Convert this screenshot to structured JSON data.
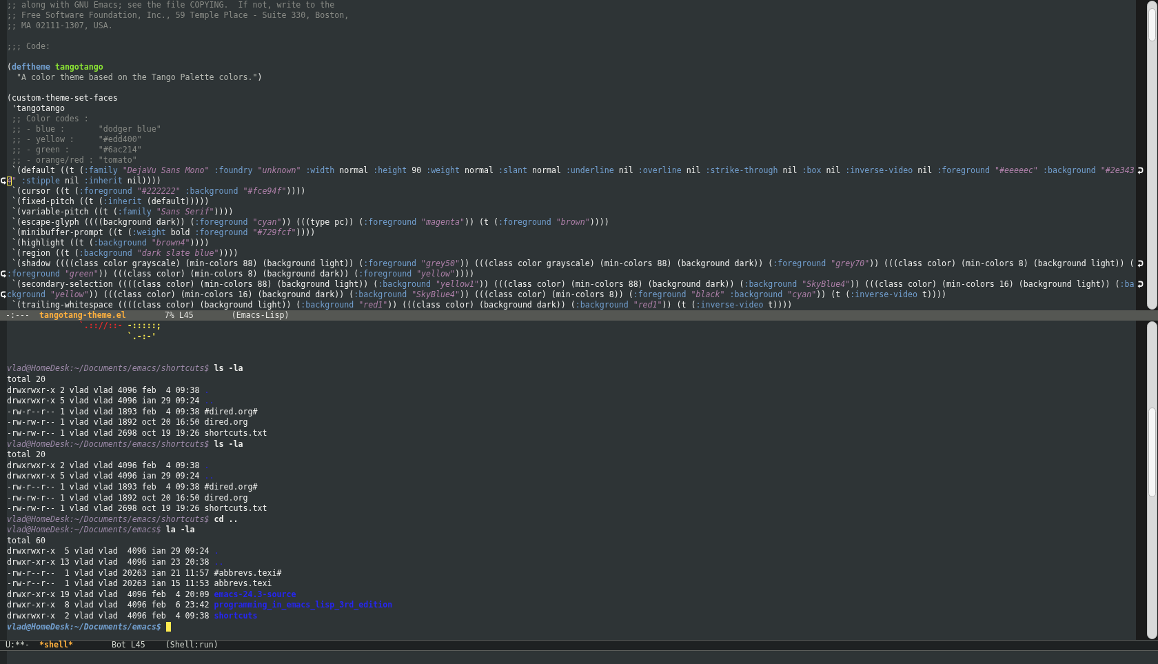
{
  "windows": [
    {
      "selected": false,
      "lines": [
        {
          "kind": "text",
          "wrapped": false,
          "continued": false,
          "cursor": false,
          "segments": [
            {
              "kind": "comment",
              "text": ";; along with GNU Emacs; see the file COPYING.  If not, write to the"
            }
          ]
        },
        {
          "kind": "text",
          "wrapped": false,
          "continued": false,
          "cursor": false,
          "segments": [
            {
              "kind": "comment",
              "text": ";; Free Software Foundation, Inc., 59 Temple Place - Suite 330, Boston,"
            }
          ]
        },
        {
          "kind": "text",
          "wrapped": false,
          "continued": false,
          "cursor": false,
          "segments": [
            {
              "kind": "comment",
              "text": ";; MA 02111-1307, USA."
            }
          ]
        },
        {
          "kind": "blank",
          "wrapped": false,
          "continued": false,
          "cursor": false
        },
        {
          "kind": "text",
          "wrapped": false,
          "continued": false,
          "cursor": false,
          "segments": [
            {
              "kind": "comment",
              "text": ";;; Code:"
            }
          ]
        },
        {
          "kind": "blank",
          "wrapped": false,
          "continued": false,
          "cursor": false
        },
        {
          "kind": "text",
          "wrapped": false,
          "continued": false,
          "cursor": false,
          "segments": [
            {
              "kind": "plain",
              "text": "("
            },
            {
              "kind": "builtin",
              "text": "deftheme "
            },
            {
              "kind": "function",
              "text": "tangotango"
            }
          ]
        },
        {
          "kind": "text",
          "wrapped": false,
          "continued": false,
          "cursor": false,
          "segments": [
            {
              "kind": "doc",
              "text": "  \"A color theme based on the Tango Palette colors.\""
            },
            {
              "kind": "plain",
              "text": ")"
            }
          ]
        },
        {
          "kind": "blank",
          "wrapped": false,
          "continued": false,
          "cursor": false
        },
        {
          "kind": "text",
          "wrapped": false,
          "continued": false,
          "cursor": false,
          "segments": [
            {
              "kind": "plain",
              "text": "(custom-theme-set-faces"
            }
          ]
        },
        {
          "kind": "text",
          "wrapped": false,
          "continued": false,
          "cursor": false,
          "segments": [
            {
              "kind": "plain",
              "text": " 'tangotango"
            }
          ]
        },
        {
          "kind": "text",
          "wrapped": false,
          "continued": false,
          "cursor": false,
          "segments": [
            {
              "kind": "comment",
              "text": " ;; Color codes :"
            }
          ]
        },
        {
          "kind": "text",
          "wrapped": false,
          "continued": false,
          "cursor": false,
          "segments": [
            {
              "kind": "comment",
              "text": " ;; - blue :       \"dodger blue\""
            }
          ]
        },
        {
          "kind": "text",
          "wrapped": false,
          "continued": false,
          "cursor": false,
          "segments": [
            {
              "kind": "comment",
              "text": " ;; - yellow :     \"#edd400\""
            }
          ]
        },
        {
          "kind": "text",
          "wrapped": false,
          "continued": false,
          "cursor": false,
          "segments": [
            {
              "kind": "comment",
              "text": " ;; - green :      \"#6ac214\""
            }
          ]
        },
        {
          "kind": "text",
          "wrapped": false,
          "continued": false,
          "cursor": false,
          "segments": [
            {
              "kind": "comment",
              "text": " ;; - orange/red : \"tomato\""
            }
          ]
        },
        {
          "kind": "text",
          "wrapped": true,
          "continued": false,
          "cursor": false,
          "segments": [
            {
              "kind": "plain",
              "text": " `(default ((t ("
            },
            {
              "kind": "keyword",
              "text": ":family "
            },
            {
              "kind": "string",
              "text": "\"DejaVu Sans Mono\""
            },
            {
              "kind": "keyword",
              "text": " :foundry "
            },
            {
              "kind": "string",
              "text": "\"unknown\""
            },
            {
              "kind": "keyword",
              "text": " :width "
            },
            {
              "kind": "plain",
              "text": "normal "
            },
            {
              "kind": "keyword",
              "text": ":height "
            },
            {
              "kind": "plain",
              "text": "90 "
            },
            {
              "kind": "keyword",
              "text": ":weight "
            },
            {
              "kind": "plain",
              "text": "normal "
            },
            {
              "kind": "keyword",
              "text": ":slant "
            },
            {
              "kind": "plain",
              "text": "normal "
            },
            {
              "kind": "keyword",
              "text": ":underline "
            },
            {
              "kind": "plain",
              "text": "nil "
            },
            {
              "kind": "keyword",
              "text": ":overline "
            },
            {
              "kind": "plain",
              "text": "nil "
            },
            {
              "kind": "keyword",
              "text": ":strike-through "
            },
            {
              "kind": "plain",
              "text": "nil "
            },
            {
              "kind": "keyword",
              "text": ":box "
            },
            {
              "kind": "plain",
              "text": "nil "
            },
            {
              "kind": "keyword",
              "text": ":inverse-video "
            },
            {
              "kind": "plain",
              "text": "nil "
            },
            {
              "kind": "keyword",
              "text": ":foreground "
            },
            {
              "kind": "string",
              "text": "\"#eeeeec\""
            },
            {
              "kind": "keyword",
              "text": " :background "
            },
            {
              "kind": "string",
              "text": "\"#2e343"
            }
          ]
        },
        {
          "kind": "text",
          "wrapped": false,
          "continued": true,
          "cursor": true,
          "segments": [
            {
              "kind": "string",
              "text": "4\""
            },
            {
              "kind": "keyword",
              "text": " :stipple "
            },
            {
              "kind": "plain",
              "text": "nil "
            },
            {
              "kind": "keyword",
              "text": ":inherit "
            },
            {
              "kind": "plain",
              "text": "nil))))"
            }
          ]
        },
        {
          "kind": "text",
          "wrapped": false,
          "continued": false,
          "cursor": false,
          "segments": [
            {
              "kind": "plain",
              "text": " `(cursor ((t ("
            },
            {
              "kind": "keyword",
              "text": ":foreground "
            },
            {
              "kind": "string",
              "text": "\"#222222\""
            },
            {
              "kind": "keyword",
              "text": " :background "
            },
            {
              "kind": "string",
              "text": "\"#fce94f\""
            },
            {
              "kind": "plain",
              "text": "))))"
            }
          ]
        },
        {
          "kind": "text",
          "wrapped": false,
          "continued": false,
          "cursor": false,
          "segments": [
            {
              "kind": "plain",
              "text": " `(fixed-pitch ((t ("
            },
            {
              "kind": "keyword",
              "text": ":inherit "
            },
            {
              "kind": "plain",
              "text": "(default)))))"
            }
          ]
        },
        {
          "kind": "text",
          "wrapped": false,
          "continued": false,
          "cursor": false,
          "segments": [
            {
              "kind": "plain",
              "text": " `(variable-pitch ((t ("
            },
            {
              "kind": "keyword",
              "text": ":family "
            },
            {
              "kind": "string",
              "text": "\"Sans Serif\""
            },
            {
              "kind": "plain",
              "text": "))))"
            }
          ]
        },
        {
          "kind": "text",
          "wrapped": false,
          "continued": false,
          "cursor": false,
          "segments": [
            {
              "kind": "plain",
              "text": " `(escape-glyph ((((background dark)) ("
            },
            {
              "kind": "keyword",
              "text": ":foreground "
            },
            {
              "kind": "string",
              "text": "\"cyan\""
            },
            {
              "kind": "plain",
              "text": ")) (((type pc)) ("
            },
            {
              "kind": "keyword",
              "text": ":foreground "
            },
            {
              "kind": "string",
              "text": "\"magenta\""
            },
            {
              "kind": "plain",
              "text": ")) (t ("
            },
            {
              "kind": "keyword",
              "text": ":foreground "
            },
            {
              "kind": "string",
              "text": "\"brown\""
            },
            {
              "kind": "plain",
              "text": "))))"
            }
          ]
        },
        {
          "kind": "text",
          "wrapped": false,
          "continued": false,
          "cursor": false,
          "segments": [
            {
              "kind": "plain",
              "text": " `(minibuffer-prompt ((t ("
            },
            {
              "kind": "keyword",
              "text": ":weight "
            },
            {
              "kind": "plain",
              "text": "bold "
            },
            {
              "kind": "keyword",
              "text": ":foreground "
            },
            {
              "kind": "string",
              "text": "\"#729fcf\""
            },
            {
              "kind": "plain",
              "text": "))))"
            }
          ]
        },
        {
          "kind": "text",
          "wrapped": false,
          "continued": false,
          "cursor": false,
          "segments": [
            {
              "kind": "plain",
              "text": " `(highlight ((t ("
            },
            {
              "kind": "keyword",
              "text": ":background "
            },
            {
              "kind": "string",
              "text": "\"brown4\""
            },
            {
              "kind": "plain",
              "text": "))))"
            }
          ]
        },
        {
          "kind": "text",
          "wrapped": false,
          "continued": false,
          "cursor": false,
          "segments": [
            {
              "kind": "plain",
              "text": " `(region ((t ("
            },
            {
              "kind": "keyword",
              "text": ":background "
            },
            {
              "kind": "string",
              "text": "\"dark slate blue\""
            },
            {
              "kind": "plain",
              "text": "))))"
            }
          ]
        },
        {
          "kind": "text",
          "wrapped": true,
          "continued": false,
          "cursor": false,
          "segments": [
            {
              "kind": "plain",
              "text": " `(shadow ((((class color grayscale) (min-colors 88) (background light)) ("
            },
            {
              "kind": "keyword",
              "text": ":foreground "
            },
            {
              "kind": "string",
              "text": "\"grey50\""
            },
            {
              "kind": "plain",
              "text": ")) (((class color grayscale) (min-colors 88) (background dark)) ("
            },
            {
              "kind": "keyword",
              "text": ":foreground "
            },
            {
              "kind": "string",
              "text": "\"grey70\""
            },
            {
              "kind": "plain",
              "text": ")) (((class color) (min-colors 8) (background light)) ("
            }
          ]
        },
        {
          "kind": "text",
          "wrapped": false,
          "continued": true,
          "cursor": false,
          "segments": [
            {
              "kind": "keyword",
              "text": ":foreground "
            },
            {
              "kind": "string",
              "text": "\"green\""
            },
            {
              "kind": "plain",
              "text": ")) (((class color) (min-colors 8) (background dark)) ("
            },
            {
              "kind": "keyword",
              "text": ":foreground "
            },
            {
              "kind": "string",
              "text": "\"yellow\""
            },
            {
              "kind": "plain",
              "text": "))))"
            }
          ]
        },
        {
          "kind": "text",
          "wrapped": true,
          "continued": false,
          "cursor": false,
          "segments": [
            {
              "kind": "plain",
              "text": " `(secondary-selection ((((class color) (min-colors 88) (background light)) ("
            },
            {
              "kind": "keyword",
              "text": ":background "
            },
            {
              "kind": "string",
              "text": "\"yellow1\""
            },
            {
              "kind": "plain",
              "text": ")) (((class color) (min-colors 88) (background dark)) ("
            },
            {
              "kind": "keyword",
              "text": ":background "
            },
            {
              "kind": "string",
              "text": "\"SkyBlue4\""
            },
            {
              "kind": "plain",
              "text": ")) (((class color) (min-colors 16) (background light)) ("
            },
            {
              "kind": "keyword",
              "text": ":ba"
            }
          ]
        },
        {
          "kind": "text",
          "wrapped": false,
          "continued": true,
          "cursor": false,
          "segments": [
            {
              "kind": "keyword",
              "text": "ckground "
            },
            {
              "kind": "string",
              "text": "\"yellow\""
            },
            {
              "kind": "plain",
              "text": ")) (((class color) (min-colors 16) (background dark)) ("
            },
            {
              "kind": "keyword",
              "text": ":background "
            },
            {
              "kind": "string",
              "text": "\"SkyBlue4\""
            },
            {
              "kind": "plain",
              "text": ")) (((class color) (min-colors 8)) ("
            },
            {
              "kind": "keyword",
              "text": ":foreground "
            },
            {
              "kind": "string",
              "text": "\"black\""
            },
            {
              "kind": "keyword",
              "text": " :background "
            },
            {
              "kind": "string",
              "text": "\"cyan\""
            },
            {
              "kind": "plain",
              "text": ")) (t ("
            },
            {
              "kind": "keyword",
              "text": ":inverse-video "
            },
            {
              "kind": "plain",
              "text": "t))))"
            }
          ]
        },
        {
          "kind": "text",
          "wrapped": false,
          "continued": false,
          "cursor": false,
          "segments": [
            {
              "kind": "plain",
              "text": " `(trailing-whitespace ((((class color) (background light)) ("
            },
            {
              "kind": "keyword",
              "text": ":background "
            },
            {
              "kind": "string",
              "text": "\"red1\""
            },
            {
              "kind": "plain",
              "text": ")) (((class color) (background dark)) ("
            },
            {
              "kind": "keyword",
              "text": ":background "
            },
            {
              "kind": "string",
              "text": "\"red1\""
            },
            {
              "kind": "plain",
              "text": ")) (t ("
            },
            {
              "kind": "keyword",
              "text": ":inverse-video "
            },
            {
              "kind": "plain",
              "text": "t))))"
            }
          ]
        }
      ],
      "mode_line": {
        "status": "-:---",
        "buffer_name": "tangotang-theme.el",
        "position": "7% L45",
        "major_mode": "(Emacs-Lisp)"
      }
    },
    {
      "selected": true,
      "lines": [
        {
          "kind": "text",
          "cursor": false,
          "segments": [
            {
              "kind": "art-red",
              "text": "               `.:://::-"
            },
            {
              "kind": "art-yellow",
              "text": " -:::::;"
            }
          ]
        },
        {
          "kind": "text",
          "cursor": false,
          "segments": [
            {
              "kind": "art-yellow",
              "text": "                         `.-:-'"
            }
          ]
        },
        {
          "kind": "blank",
          "cursor": false
        },
        {
          "kind": "blank",
          "cursor": false
        },
        {
          "kind": "text",
          "cursor": false,
          "segments": [
            {
              "kind": "prompt",
              "text": "vlad@HomeDesk:~/Documents/emacs/shortcuts$"
            },
            {
              "kind": "command",
              "text": " ls -la"
            }
          ]
        },
        {
          "kind": "text",
          "cursor": false,
          "segments": [
            {
              "kind": "output",
              "text": "total 20"
            }
          ]
        },
        {
          "kind": "text",
          "cursor": false,
          "segments": [
            {
              "kind": "output",
              "text": "drwxrwxr-x 2 vlad vlad 4096 feb  4 09:38 "
            },
            {
              "kind": "dir",
              "text": "."
            }
          ]
        },
        {
          "kind": "text",
          "cursor": false,
          "segments": [
            {
              "kind": "output",
              "text": "drwxrwxr-x 5 vlad vlad 4096 ian 29 09:24 "
            },
            {
              "kind": "dir",
              "text": ".."
            }
          ]
        },
        {
          "kind": "text",
          "cursor": false,
          "segments": [
            {
              "kind": "output",
              "text": "-rw-r--r-- 1 vlad vlad 1893 feb  4 09:38 #dired.org#"
            }
          ]
        },
        {
          "kind": "text",
          "cursor": false,
          "segments": [
            {
              "kind": "output",
              "text": "-rw-rw-r-- 1 vlad vlad 1892 oct 20 16:50 dired.org"
            }
          ]
        },
        {
          "kind": "text",
          "cursor": false,
          "segments": [
            {
              "kind": "output",
              "text": "-rw-rw-r-- 1 vlad vlad 2698 oct 19 19:26 shortcuts.txt"
            }
          ]
        },
        {
          "kind": "text",
          "cursor": false,
          "segments": [
            {
              "kind": "prompt",
              "text": "vlad@HomeDesk:~/Documents/emacs/shortcuts$"
            },
            {
              "kind": "command",
              "text": " ls -la"
            }
          ]
        },
        {
          "kind": "text",
          "cursor": false,
          "segments": [
            {
              "kind": "output",
              "text": "total 20"
            }
          ]
        },
        {
          "kind": "text",
          "cursor": false,
          "segments": [
            {
              "kind": "output",
              "text": "drwxrwxr-x 2 vlad vlad 4096 feb  4 09:38 "
            },
            {
              "kind": "dir",
              "text": "."
            }
          ]
        },
        {
          "kind": "text",
          "cursor": false,
          "segments": [
            {
              "kind": "output",
              "text": "drwxrwxr-x 5 vlad vlad 4096 ian 29 09:24 "
            },
            {
              "kind": "dir",
              "text": ".."
            }
          ]
        },
        {
          "kind": "text",
          "cursor": false,
          "segments": [
            {
              "kind": "output",
              "text": "-rw-r--r-- 1 vlad vlad 1893 feb  4 09:38 #dired.org#"
            }
          ]
        },
        {
          "kind": "text",
          "cursor": false,
          "segments": [
            {
              "kind": "output",
              "text": "-rw-rw-r-- 1 vlad vlad 1892 oct 20 16:50 dired.org"
            }
          ]
        },
        {
          "kind": "text",
          "cursor": false,
          "segments": [
            {
              "kind": "output",
              "text": "-rw-rw-r-- 1 vlad vlad 2698 oct 19 19:26 shortcuts.txt"
            }
          ]
        },
        {
          "kind": "text",
          "cursor": false,
          "segments": [
            {
              "kind": "prompt",
              "text": "vlad@HomeDesk:~/Documents/emacs/shortcuts$"
            },
            {
              "kind": "command",
              "text": " cd .."
            }
          ]
        },
        {
          "kind": "text",
          "cursor": false,
          "segments": [
            {
              "kind": "prompt",
              "text": "vlad@HomeDesk:~/Documents/emacs$"
            },
            {
              "kind": "command",
              "text": " la -la"
            }
          ]
        },
        {
          "kind": "text",
          "cursor": false,
          "segments": [
            {
              "kind": "output",
              "text": "total 60"
            }
          ]
        },
        {
          "kind": "text",
          "cursor": false,
          "segments": [
            {
              "kind": "output",
              "text": "drwxrwxr-x  5 vlad vlad  4096 ian 29 09:24 "
            },
            {
              "kind": "dir",
              "text": "."
            }
          ]
        },
        {
          "kind": "text",
          "cursor": false,
          "segments": [
            {
              "kind": "output",
              "text": "drwxr-xr-x 13 vlad vlad  4096 ian 23 20:38 "
            },
            {
              "kind": "dir",
              "text": ".."
            }
          ]
        },
        {
          "kind": "text",
          "cursor": false,
          "segments": [
            {
              "kind": "output",
              "text": "-rw-r--r--  1 vlad vlad 20263 ian 21 11:57 #abbrevs.texi#"
            }
          ]
        },
        {
          "kind": "text",
          "cursor": false,
          "segments": [
            {
              "kind": "output",
              "text": "-rw-r--r--  1 vlad vlad 20263 ian 15 11:53 abbrevs.texi"
            }
          ]
        },
        {
          "kind": "text",
          "cursor": false,
          "segments": [
            {
              "kind": "output",
              "text": "drwxr-xr-x 19 vlad vlad  4096 feb  4 20:09 "
            },
            {
              "kind": "dir-bold",
              "text": "emacs-24.3-source"
            }
          ]
        },
        {
          "kind": "text",
          "cursor": false,
          "segments": [
            {
              "kind": "output",
              "text": "drwxr-xr-x  8 vlad vlad  4096 feb  6 23:42 "
            },
            {
              "kind": "dir-bold",
              "text": "programming_in_emacs_lisp_3rd_edition"
            }
          ]
        },
        {
          "kind": "text",
          "cursor": false,
          "segments": [
            {
              "kind": "output",
              "text": "drwxrwxr-x  2 vlad vlad  4096 feb  4 09:38 "
            },
            {
              "kind": "dir-bold",
              "text": "shortcuts"
            }
          ]
        },
        {
          "kind": "text",
          "cursor": true,
          "segments": [
            {
              "kind": "prompt-current",
              "text": "vlad@HomeDesk:~/Documents/emacs$"
            }
          ]
        }
      ],
      "mode_line": {
        "status": "U:**-",
        "buffer_name": "*shell*",
        "position": "Bot L45",
        "major_mode": "(Shell:run)"
      }
    }
  ]
}
